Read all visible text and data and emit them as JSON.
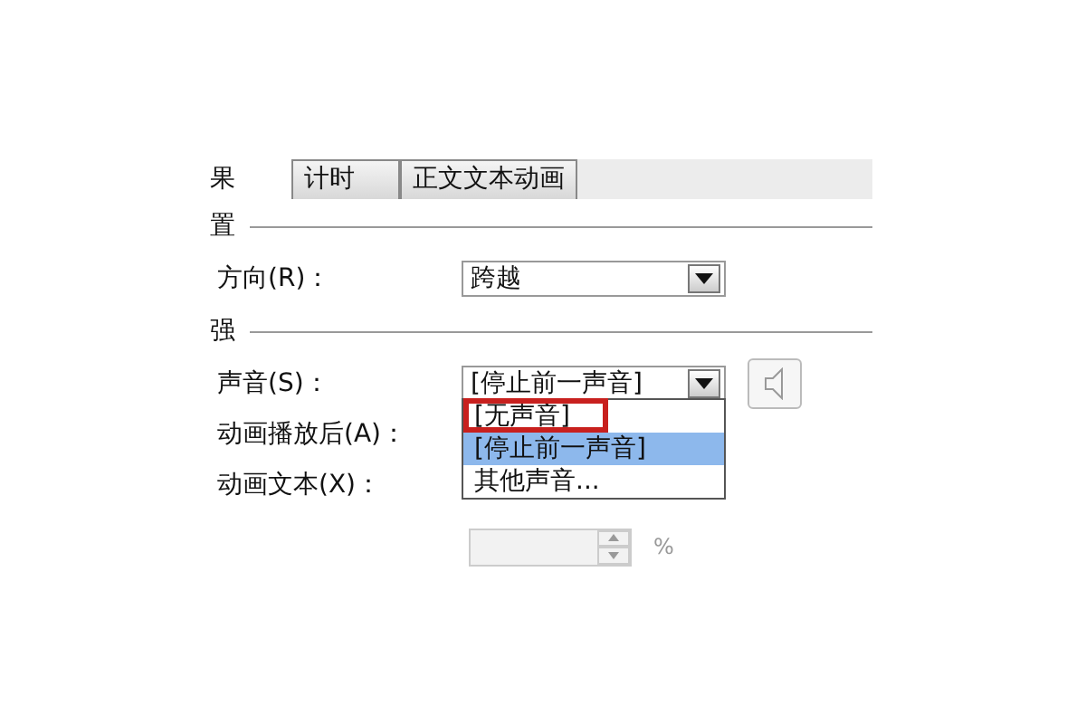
{
  "tab_row": {
    "fragment": "果",
    "tabs": [
      {
        "label": "计时",
        "selected": false
      },
      {
        "label": "正文文本动画",
        "selected": false
      }
    ]
  },
  "sections": [
    {
      "title": "置",
      "fields": [
        {
          "kind": "dropdown",
          "label": "方向(R)：",
          "value": "跨越"
        }
      ]
    },
    {
      "title": "强",
      "fields": [
        {
          "kind": "dropdown_open",
          "label": "声音(S)：",
          "value": "[停止前一声音]",
          "options": [
            {
              "label": "[无声音]",
              "selected": false,
              "highlighted": true
            },
            {
              "label": "[停止前一声音]",
              "selected": true,
              "highlighted": false
            },
            {
              "label": "其他声音...",
              "selected": false,
              "highlighted": false
            }
          ]
        },
        {
          "kind": "label_only",
          "label": "动画播放后(A)："
        },
        {
          "kind": "label_only",
          "label": "动画文本(X)："
        },
        {
          "kind": "spin",
          "unit": "%",
          "disabled": true
        }
      ]
    }
  ]
}
